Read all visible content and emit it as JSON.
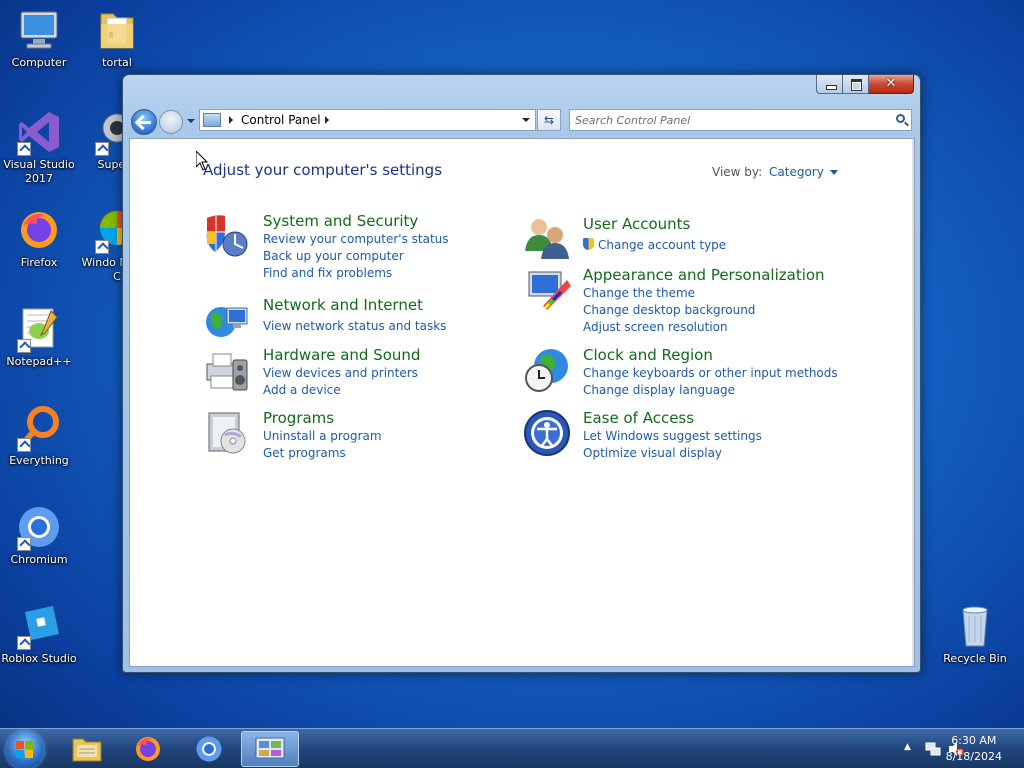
{
  "desktop": {
    "icons": [
      {
        "label": "Computer"
      },
      {
        "label": "tortal"
      },
      {
        "label": "Visual Studio 2017"
      },
      {
        "label": "Supern"
      },
      {
        "label": "Firefox"
      },
      {
        "label": "Windo Media C"
      },
      {
        "label": "Notepad++"
      },
      {
        "label": "Everything"
      },
      {
        "label": "Chromium"
      },
      {
        "label": "Roblox Studio"
      },
      {
        "label": "Recycle Bin"
      }
    ]
  },
  "window": {
    "address_root": "Control Panel",
    "search_placeholder": "Search Control Panel",
    "close_glyph": "✕",
    "refresh_glyph": "⇆",
    "heading": "Adjust your computer's settings",
    "view_by_label": "View by:",
    "view_by_value": "Category",
    "categories": [
      {
        "title": "System and Security",
        "links": [
          "Review your computer's status",
          "Back up your computer",
          "Find and fix problems"
        ]
      },
      {
        "title": "Network and Internet",
        "links": [
          "View network status and tasks"
        ]
      },
      {
        "title": "Hardware and Sound",
        "links": [
          "View devices and printers",
          "Add a device"
        ]
      },
      {
        "title": "Programs",
        "links": [
          "Uninstall a program",
          "Get programs"
        ]
      },
      {
        "title": "User Accounts",
        "links": [
          "Change account type"
        ]
      },
      {
        "title": "Appearance and Personalization",
        "links": [
          "Change the theme",
          "Change desktop background",
          "Adjust screen resolution"
        ]
      },
      {
        "title": "Clock and Region",
        "links": [
          "Change keyboards or other input methods",
          "Change display language"
        ]
      },
      {
        "title": "Ease of Access",
        "links": [
          "Let Windows suggest settings",
          "Optimize visual display"
        ]
      }
    ]
  },
  "taskbar": {
    "time": "6:30 AM",
    "date": "8/18/2024",
    "tray_arrow": "▲"
  },
  "colors": {
    "category_title": "#126b1a",
    "link": "#1e5aa8",
    "heading": "#1e3287"
  }
}
